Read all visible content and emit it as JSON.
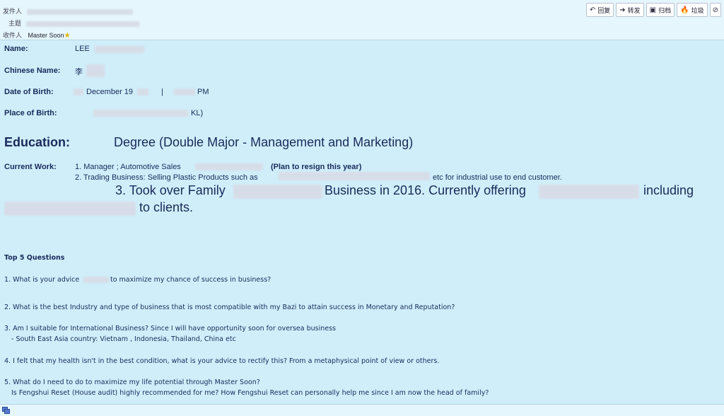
{
  "header": {
    "from_label": "发件人",
    "subject_label": "主题",
    "to_label": "收件人",
    "to_value": "Master Soon"
  },
  "toolbar": {
    "reply": "回复",
    "forward": "转发",
    "archive": "归档",
    "junk": "垃圾"
  },
  "profile": {
    "name_label": "Name:",
    "name_value": "LEE",
    "chinese_name_label": "Chinese Name:",
    "chinese_name_value": "李",
    "dob_label": "Date of Birth:",
    "dob_value": "December 19",
    "dob_sep": "|",
    "dob_time": "PM",
    "pob_label": "Place of Birth:",
    "pob_value": "KL)",
    "education_label": "Education:",
    "education_value": "Degree (Double Major - Management and Marketing)",
    "current_work_label": "Current Work:",
    "work_1a": "1. Manager ;  Automotive Sales",
    "work_1b": "(Plan to resign this year)",
    "work_2a": "2. Trading Business: Selling Plastic Products such as",
    "work_2b": "etc for industrial use to end customer.",
    "work_3a": "3. Took over Family",
    "work_3b": "Business in 2016. Currently offering",
    "work_3c": "including",
    "work_3d": "to clients."
  },
  "questions": {
    "heading": "Top 5 Questions",
    "q1a": "1. What is your advice",
    "q1b": "to maximize my chance of success in business?",
    "q2": "2. What is the best Industry and type of business that is most compatible with my Bazi to attain success in Monetary and Reputation?",
    "q3a": "3. Am I suitable for International Business? Since I will have opportunity soon for oversea business",
    "q3b": "- South East Asia country: Vietnam , Indonesia, Thailand, China etc",
    "q4": "4. I felt that my health isn't in the best condition, what is your advice to rectify this? From a metaphysical point of view or others.",
    "q5a": "5. What do I need to do to maximize my life potential through Master Soon?",
    "q5b": "Is Fengshui Reset (House audit) highly recommended for me? How Fengshui Reset can personally help me since I am now the head of family?"
  },
  "icons": [
    "reply-icon",
    "forward-icon",
    "archive-icon",
    "junk-icon",
    "block-icon",
    "star-icon",
    "status-icon"
  ]
}
